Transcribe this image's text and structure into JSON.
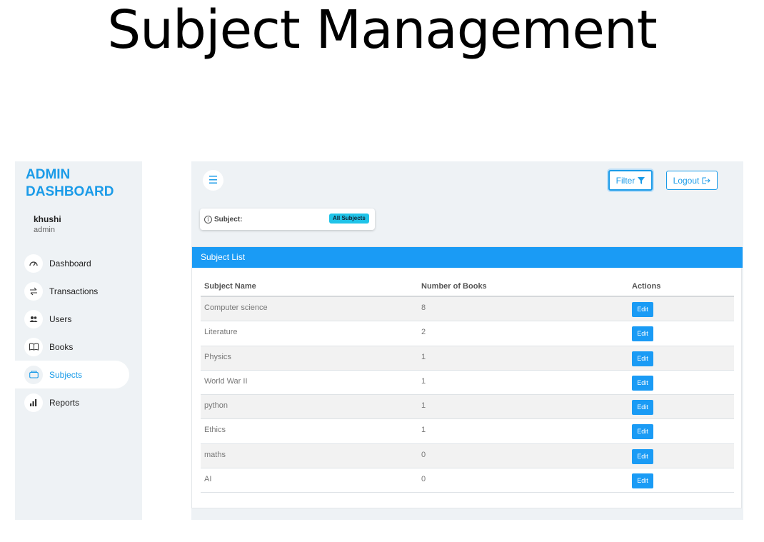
{
  "page_title": "Subject Management",
  "sidebar": {
    "brand": "ADMIN DASHBOARD",
    "user": {
      "name": "khushi",
      "role": "admin"
    },
    "items": [
      {
        "label": "Dashboard",
        "icon": "dashboard-icon",
        "active": false
      },
      {
        "label": "Transactions",
        "icon": "transactions-icon",
        "active": false
      },
      {
        "label": "Users",
        "icon": "users-icon",
        "active": false
      },
      {
        "label": "Books",
        "icon": "book-icon",
        "active": false
      },
      {
        "label": "Subjects",
        "icon": "subjects-icon",
        "active": true
      },
      {
        "label": "Reports",
        "icon": "reports-icon",
        "active": false
      }
    ]
  },
  "topbar": {
    "filter_label": "Filter",
    "logout_label": "Logout"
  },
  "filter": {
    "label": "Subject:",
    "selected": "All Subjects"
  },
  "subject_list": {
    "title": "Subject List",
    "columns": [
      "Subject Name",
      "Number of Books",
      "Actions"
    ],
    "edit_label": "Edit",
    "rows": [
      {
        "name": "Computer science",
        "books": "8"
      },
      {
        "name": "Literature",
        "books": "2"
      },
      {
        "name": "Physics",
        "books": "1"
      },
      {
        "name": "World War II",
        "books": "1"
      },
      {
        "name": "python",
        "books": "1"
      },
      {
        "name": "Ethics",
        "books": "1"
      },
      {
        "name": "maths",
        "books": "0"
      },
      {
        "name": "AI",
        "books": "0"
      }
    ]
  },
  "colors": {
    "accent": "#1a9bf5",
    "badge": "#1fc3e8",
    "sidebar_bg": "#eef2f5"
  }
}
